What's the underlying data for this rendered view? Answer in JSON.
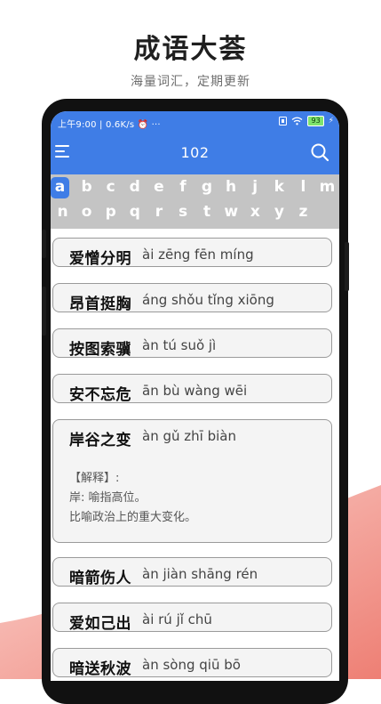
{
  "promo": {
    "title": "成语大荟",
    "subtitle": "海量词汇，定期更新"
  },
  "status_bar": {
    "left": "上午9:00 | 0.6K/s ⏰ ···",
    "battery": "93"
  },
  "app_bar": {
    "title": "102"
  },
  "alphabet": {
    "row1": [
      "a",
      "b",
      "c",
      "d",
      "e",
      "f",
      "g",
      "h",
      "j",
      "k",
      "l",
      "m"
    ],
    "row2": [
      "n",
      "o",
      "p",
      "q",
      "r",
      "s",
      "t",
      "w",
      "x",
      "y",
      "z"
    ],
    "active": "a"
  },
  "idioms": [
    {
      "hanzi": "爱憎分明",
      "pinyin": "ài zēng fēn míng"
    },
    {
      "hanzi": "昂首挺胸",
      "pinyin": "áng shǒu tǐng xiōng"
    },
    {
      "hanzi": "按图索骥",
      "pinyin": "àn tú suǒ jì"
    },
    {
      "hanzi": "安不忘危",
      "pinyin": "ān bù wàng wēi"
    },
    {
      "hanzi": "岸谷之变",
      "pinyin": "àn gǔ zhī biàn",
      "explanation": [
        "【解释】:",
        "岸: 喻指高位。",
        "比喻政治上的重大变化。"
      ]
    },
    {
      "hanzi": "暗箭伤人",
      "pinyin": "àn jiàn shāng rén"
    },
    {
      "hanzi": "爱如己出",
      "pinyin": "ài rú jǐ chū"
    },
    {
      "hanzi": "暗送秋波",
      "pinyin": "àn sòng qiū bō"
    }
  ],
  "colors": {
    "accent": "#3f7de6",
    "alphabet_bar": "#c4c4c4",
    "decor": "#f4a29a"
  }
}
